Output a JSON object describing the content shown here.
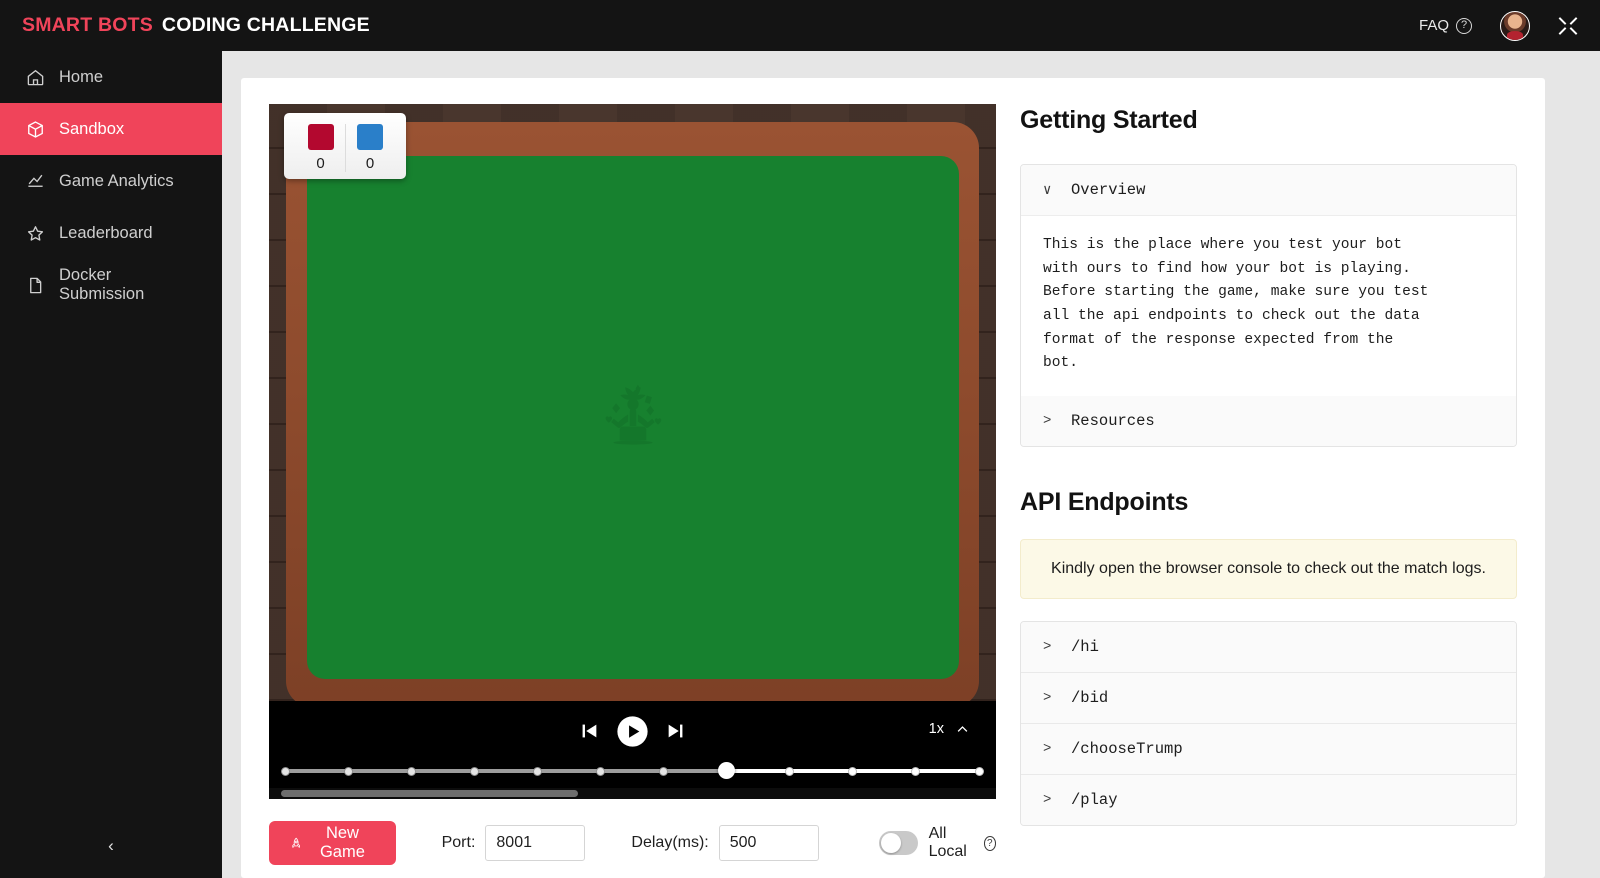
{
  "topbar": {
    "brand_primary": "SMART BOTS",
    "brand_secondary": "CODING CHALLENGE",
    "faq_label": "FAQ",
    "help_glyph": "?",
    "accent_color": "#f0445a"
  },
  "sidebar": {
    "items": [
      {
        "label": "Home",
        "icon": "home-icon",
        "active": false
      },
      {
        "label": "Sandbox",
        "icon": "cube-icon",
        "active": true
      },
      {
        "label": "Game Analytics",
        "icon": "chart-line-icon",
        "active": false
      },
      {
        "label": "Leaderboard",
        "icon": "star-icon",
        "active": false
      },
      {
        "label": "Docker Submission",
        "icon": "file-icon",
        "active": false
      }
    ],
    "collapse_glyph": "‹"
  },
  "game": {
    "score": {
      "team_a": {
        "color": "#b3082f",
        "value": "0"
      },
      "team_b": {
        "color": "#2a7fc9",
        "value": "0"
      }
    },
    "felt_color": "#17812f",
    "table_color": "#8e4b2d",
    "watermark": "joker-juggling-icon"
  },
  "player": {
    "prev_icon": "skip-previous-icon",
    "play_icon": "play-icon",
    "next_icon": "skip-next-icon",
    "speed_label": "1x",
    "speed_chevron": "chevron-up-icon",
    "timeline": {
      "steps": 12,
      "current_index": 7
    }
  },
  "controls": {
    "new_game_label": "New Game",
    "new_game_icon": "rocket-icon",
    "port_label": "Port:",
    "port_value": "8001",
    "delay_label": "Delay(ms):",
    "delay_value": "500",
    "all_local_label": "All Local",
    "all_local_on": false,
    "help_glyph": "?"
  },
  "getting_started": {
    "title": "Getting Started",
    "sections": [
      {
        "label": "Overview",
        "expanded": true,
        "chevron": "∨",
        "body": "This is the place where you test your bot\nwith ours to find how your bot is playing.\nBefore starting the game, make sure you test\nall the api endpoints to check out the data\nformat of the response expected from the\nbot."
      },
      {
        "label": "Resources",
        "expanded": false,
        "chevron": ">"
      }
    ]
  },
  "api": {
    "title": "API Endpoints",
    "notice": "Kindly open the browser console to check out the match logs.",
    "endpoints": [
      {
        "chevron": ">",
        "path": "/hi"
      },
      {
        "chevron": ">",
        "path": "/bid"
      },
      {
        "chevron": ">",
        "path": "/chooseTrump"
      },
      {
        "chevron": ">",
        "path": "/play"
      }
    ]
  }
}
